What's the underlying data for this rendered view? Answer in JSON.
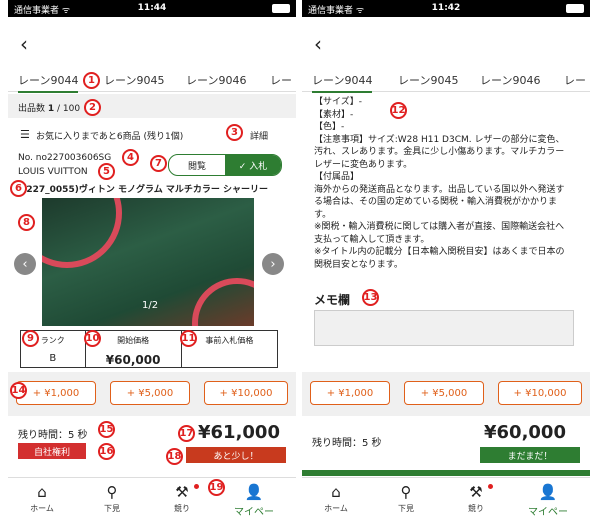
{
  "status": {
    "carrier": "通信事業者 ᯤ",
    "time_left": "11:44",
    "time_right": "11:42"
  },
  "nav": {
    "back_icon": "‹"
  },
  "tabs": [
    "レーン9044",
    "レーン9045",
    "レーン9046",
    "レー"
  ],
  "left": {
    "count_label": "出品数 ",
    "count_value": "1",
    "count_total": " / 100",
    "favorites_text": "お気に入りまであと6商品 (残り1個)",
    "detail_link": "詳細",
    "item_no": "No. no227003606SG",
    "brand": "LOUIS VUITTON",
    "toggle_view": "閲覧",
    "toggle_bid": "✓ 入札",
    "title": "(3227_0055)ヴィトン モノグラム マルチカラー シャーリー",
    "photo_counter": "1/2",
    "grid": {
      "rank_label": "ランク",
      "rank_value": "B",
      "start_label": "開始価格",
      "start_value": "¥60,000",
      "prebid_label": "事前入札価格",
      "prebid_value": ""
    },
    "buttons": [
      "+ ¥1,000",
      "+ ¥5,000",
      "+ ¥10,000"
    ],
    "remaining": "残り時間：5 秒",
    "price": "¥61,000",
    "own_right": "自社権利",
    "status_pill": "あと少し！"
  },
  "right": {
    "description": [
      "【サイズ】-",
      "【素材】-",
      "【色】-",
      "【注意事項】サイズ:W28 H11 D3CM. レザーの部分に変色、",
      "汚れ、スレあります。金具に少し小傷あります。マルチカラー",
      "レザーに変色あります。",
      "【付属品】",
      "海外からの発送商品となります。出品している国以外へ発送す",
      "る場合は、その国の定めている関税・輸入消費税がかかりま",
      "す。",
      "※関税・輸入消費税に関しては購入者が直接、国際輸送会社へ",
      "支払って輸入して頂きます。",
      "※タイトル内の記載分【日本輸入関税目安】はあくまで日本の",
      "関税目安となります。"
    ],
    "memo_title": "メモ欄",
    "buttons": [
      "+ ¥1,000",
      "+ ¥5,000",
      "+ ¥10,000"
    ],
    "remaining": "残り時間：5 秒",
    "price": "¥60,000",
    "status_pill": "まだまだ！"
  },
  "tabbar": [
    {
      "label": "ホーム",
      "icon": "home-icon",
      "glyph": "⌂"
    },
    {
      "label": "下見",
      "icon": "search-icon",
      "glyph": "⚲"
    },
    {
      "label": "競り",
      "icon": "gavel-icon",
      "glyph": "⚒"
    },
    {
      "label": "マイページ",
      "icon": "person-icon",
      "glyph": "👤"
    }
  ],
  "badges": [
    "1",
    "2",
    "3",
    "4",
    "5",
    "6",
    "7",
    "8",
    "9",
    "10",
    "11",
    "12",
    "13",
    "14",
    "15",
    "16",
    "17",
    "18",
    "19"
  ],
  "colors": {
    "accent_green": "#2e7d32",
    "badge_red": "#e02020",
    "orange": "#e0601a",
    "pill_red": "#c83a1e"
  }
}
